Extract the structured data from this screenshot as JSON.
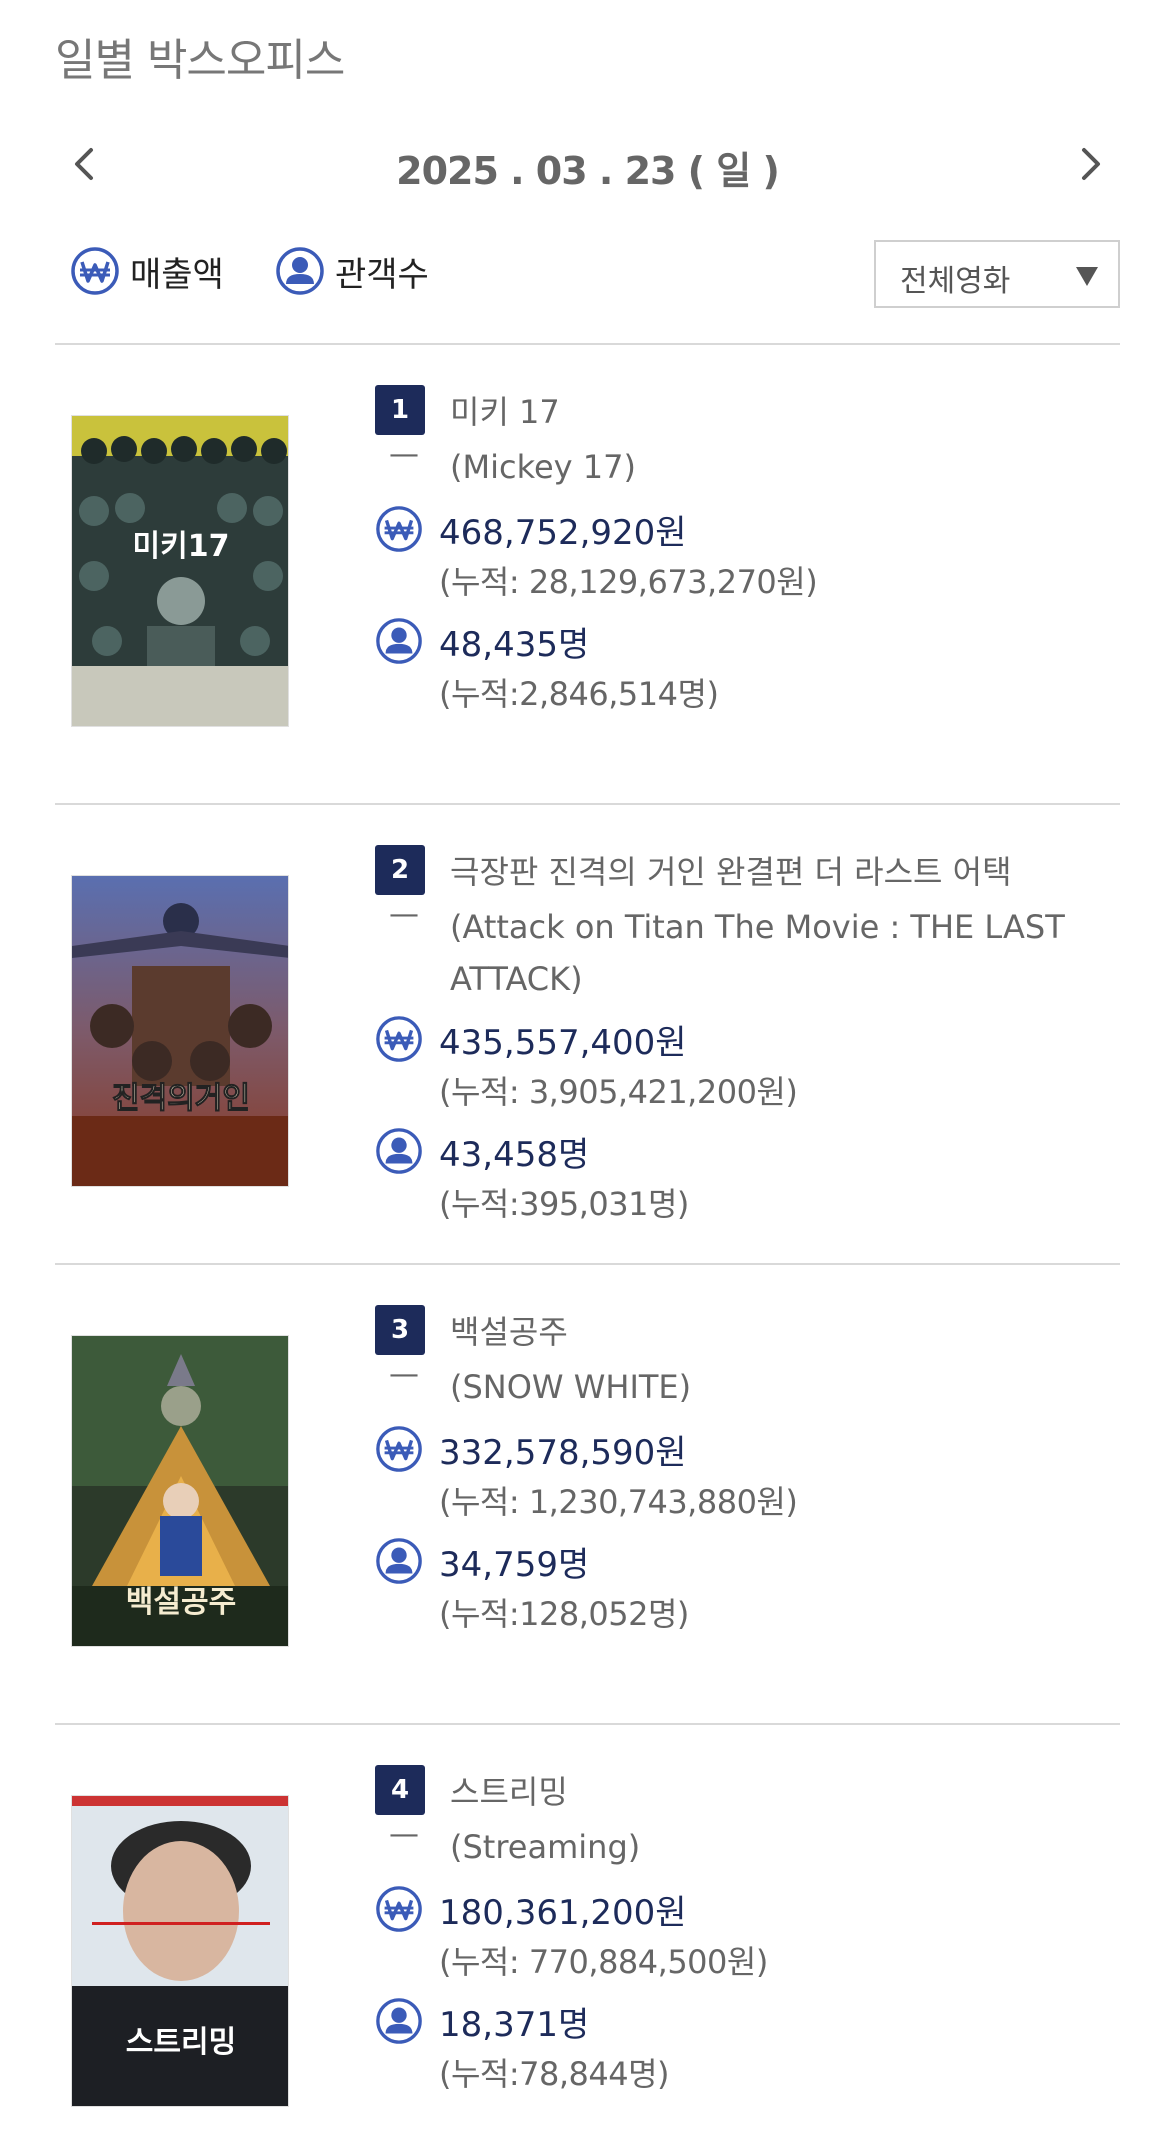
{
  "header": {
    "title": "일별 박스오피스"
  },
  "date_nav": {
    "date": "2025 . 03 . 23 ( 일 )"
  },
  "sort": {
    "sales_label": "매출액",
    "audience_label": "관객수"
  },
  "filter": {
    "selected": "전체영화"
  },
  "colors": {
    "navy": "#1d2b5a",
    "icon_blue": "#3b5bb8",
    "divider": "#d9d9d9"
  },
  "movies": [
    {
      "rank": "1",
      "title_ko": "미키 17",
      "change": "—",
      "title_en": "(Mickey 17)",
      "sales": "468,752,920원",
      "sales_cum": "(누적: 28,129,673,270원)",
      "audience": "48,435명",
      "audience_cum": "(누적:2,846,514명)",
      "poster_text": "미키17"
    },
    {
      "rank": "2",
      "title_ko": "극장판 진격의 거인 완결편 더 라스트 어택",
      "change": "—",
      "title_en": "(Attack on Titan The Movie : THE LAST ATTACK)",
      "sales": "435,557,400원",
      "sales_cum": "(누적: 3,905,421,200원)",
      "audience": "43,458명",
      "audience_cum": "(누적:395,031명)",
      "poster_text": "진격의거인"
    },
    {
      "rank": "3",
      "title_ko": "백설공주",
      "change": "—",
      "title_en": "(SNOW WHITE)",
      "sales": "332,578,590원",
      "sales_cum": "(누적: 1,230,743,880원)",
      "audience": "34,759명",
      "audience_cum": "(누적:128,052명)",
      "poster_text": "백설공주"
    },
    {
      "rank": "4",
      "title_ko": "스트리밍",
      "change": "—",
      "title_en": "(Streaming)",
      "sales": "180,361,200원",
      "sales_cum": "(누적: 770,884,500원)",
      "audience": "18,371명",
      "audience_cum": "(누적:78,844명)",
      "poster_text": "스트리밍"
    }
  ]
}
